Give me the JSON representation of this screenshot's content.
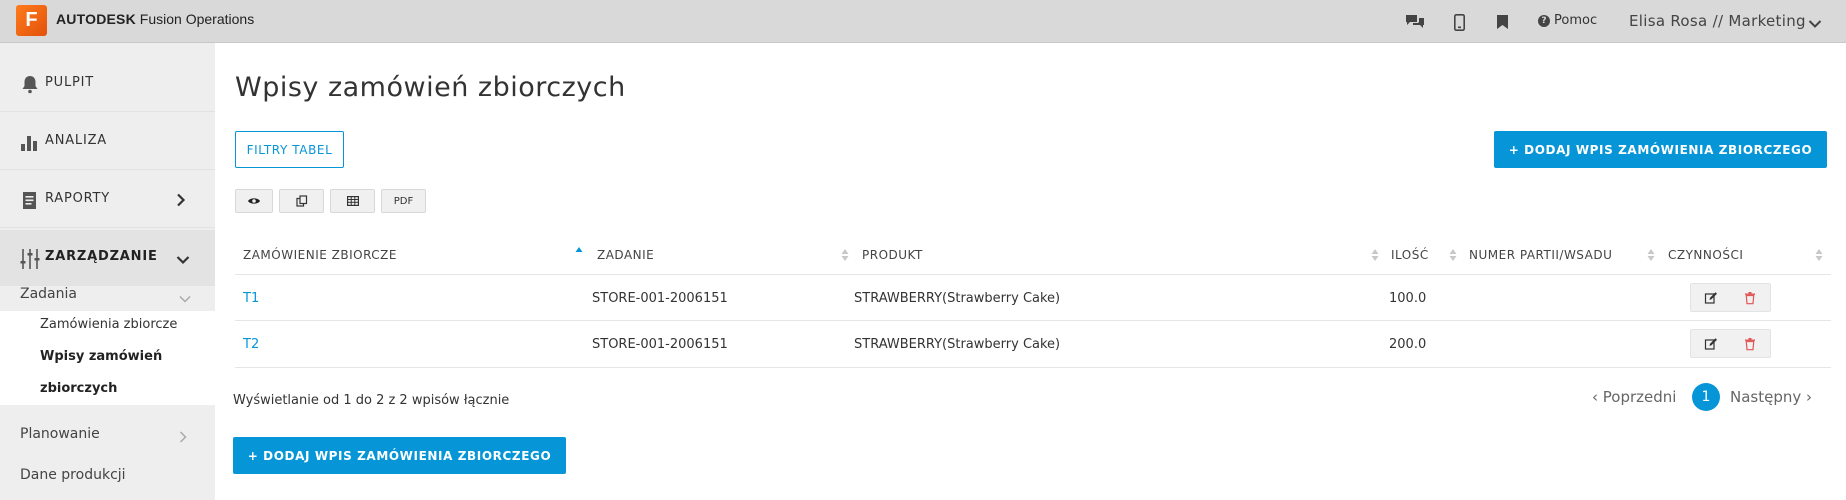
{
  "app": {
    "logo_letter": "F",
    "brand_bold": "AUTODESK",
    "brand_rest": "Fusion Operations"
  },
  "topbar": {
    "help_label": "Pomoc",
    "user_label": "Elisa Rosa // Marketing"
  },
  "sidebar": {
    "main_items": [
      {
        "label": "PULPIT",
        "icon": "bell-icon"
      },
      {
        "label": "ANALIZA",
        "icon": "bar-chart-icon"
      },
      {
        "label": "RAPORTY",
        "icon": "report-icon"
      },
      {
        "label": "ZARZĄDZANIE",
        "icon": "sliders-icon"
      }
    ],
    "sub_items": [
      {
        "label": "Zadania"
      },
      {
        "label": "Planowanie"
      },
      {
        "label": "Dane produkcji"
      }
    ],
    "subsub_items": [
      {
        "label": "Zamówienia zbiorcze"
      },
      {
        "label": "Wpisy zamówień"
      },
      {
        "label": "zbiorczych"
      }
    ]
  },
  "main": {
    "title": "Wpisy zamówień zbiorczych",
    "filter_button": "FILTRY TABEL",
    "add_button_label": "+ DODAJ WPIS ZAMÓWIENIA ZBIORCZEGO",
    "tool_pdf": "PDF"
  },
  "table": {
    "columns": [
      "ZAMÓWIENIE ZBIORCZE",
      "ZADANIE",
      "PRODUKT",
      "ILOŚĆ",
      "NUMER PARTII/WSADU",
      "CZYNNOŚCI"
    ],
    "rows": [
      {
        "order": "T1",
        "task": "STORE-001-2006151",
        "product": "STRAWBERRY(Strawberry Cake)",
        "qty": "100.0",
        "batch": ""
      },
      {
        "order": "T2",
        "task": "STORE-001-2006151",
        "product": "STRAWBERRY(Strawberry Cake)",
        "qty": "200.0",
        "batch": ""
      }
    ]
  },
  "pagination": {
    "info": "Wyświetlanie od 1 do 2 z 2 wpisów łącznie",
    "prev": "‹ Poprzedni",
    "current": "1",
    "next": "Następny ›"
  },
  "colors": {
    "accent": "#0696d7",
    "logo": "#f26f15",
    "delete": "#e05555"
  }
}
